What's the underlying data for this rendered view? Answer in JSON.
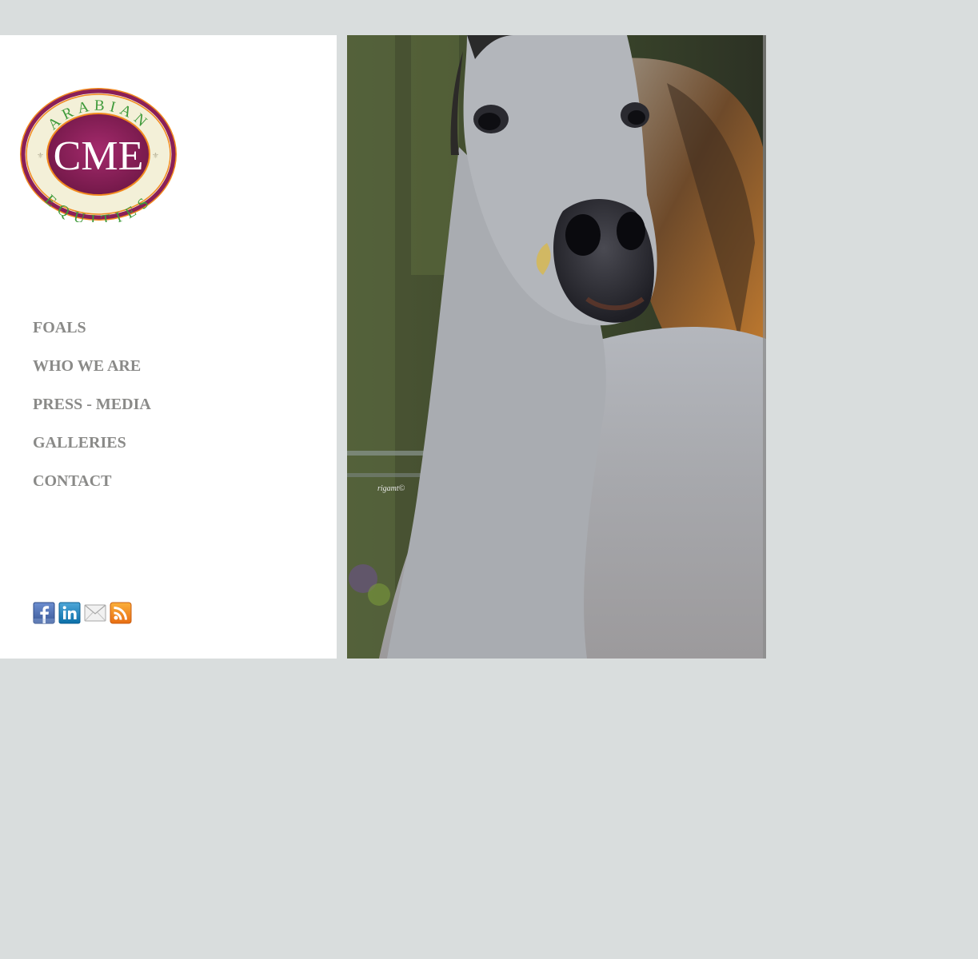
{
  "logo": {
    "top_text": "ARABIAN",
    "center_text": "CME",
    "bottom_text": "EQUITIES"
  },
  "nav": {
    "items": [
      {
        "label": "FOALS"
      },
      {
        "label": "WHO WE ARE"
      },
      {
        "label": "PRESS - MEDIA"
      },
      {
        "label": "GALLERIES"
      },
      {
        "label": "CONTACT"
      }
    ]
  },
  "social": {
    "icons": [
      "facebook-icon",
      "linkedin-icon",
      "email-icon",
      "rss-icon"
    ]
  },
  "hero": {
    "signature": "rigamt©"
  },
  "colors": {
    "page_bg": "#d9dddd",
    "nav_text": "#8a8a88",
    "logo_maroon": "#8a1f58",
    "logo_green": "#3e9a3a",
    "logo_orange": "#f28a1f"
  }
}
